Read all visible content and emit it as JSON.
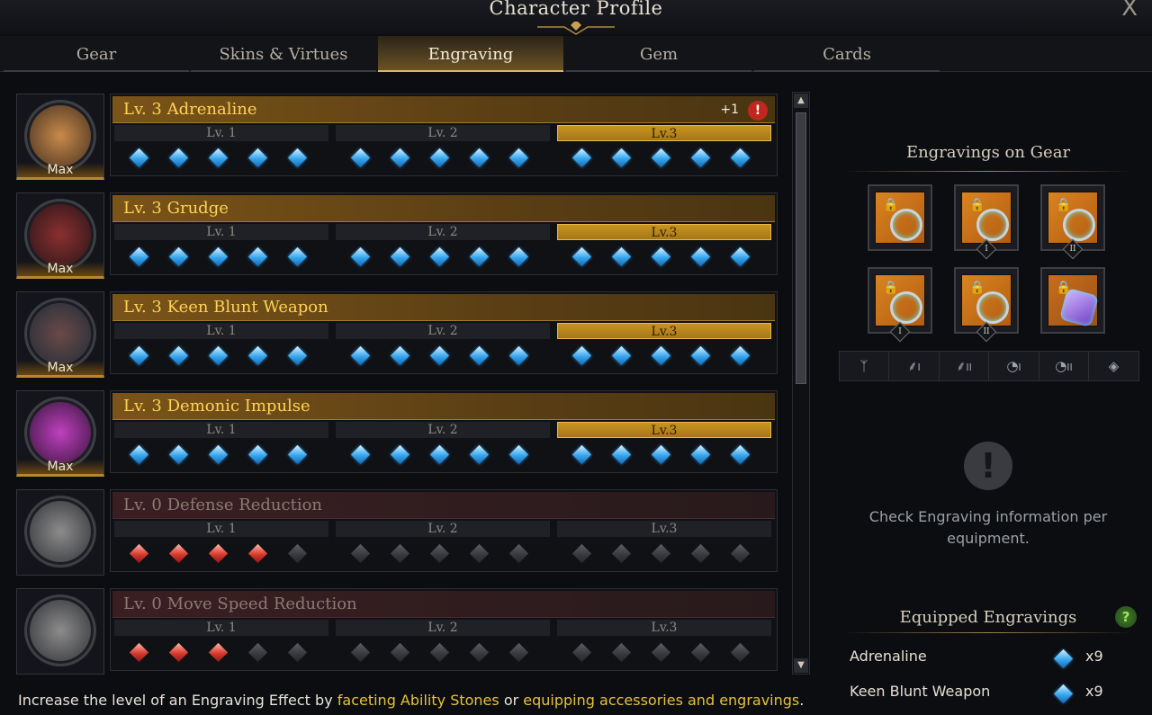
{
  "window": {
    "title": "Character Profile",
    "close_label": "X"
  },
  "tabs": [
    "Gear",
    "Skins & Virtues",
    "Engraving",
    "Gem",
    "Cards"
  ],
  "active_tab_index": 2,
  "colors": {
    "gold": "#ffd257",
    "blue_gem": "#35a6ee",
    "red_gem": "#d83a2e",
    "accent": "#e0b45a"
  },
  "engravings": [
    {
      "name": "Lv. 3 Adrenaline",
      "badge": "Max",
      "plus": "+1",
      "alert": "!",
      "state": "gold",
      "blue": 15,
      "red": 0
    },
    {
      "name": "Lv. 3 Grudge",
      "badge": "Max",
      "plus": "",
      "alert": "",
      "state": "gold",
      "blue": 15,
      "red": 0
    },
    {
      "name": "Lv. 3 Keen Blunt Weapon",
      "badge": "Max",
      "plus": "",
      "alert": "",
      "state": "gold",
      "blue": 15,
      "red": 0
    },
    {
      "name": "Lv. 3 Demonic Impulse",
      "badge": "Max",
      "plus": "",
      "alert": "",
      "state": "gold",
      "blue": 15,
      "red": 0
    },
    {
      "name": "Lv. 0 Defense Reduction",
      "badge": "",
      "plus": "",
      "alert": "",
      "state": "red",
      "blue": 0,
      "red": 4
    },
    {
      "name": "Lv. 0 Move Speed Reduction",
      "badge": "",
      "plus": "",
      "alert": "",
      "state": "red",
      "blue": 0,
      "red": 3
    }
  ],
  "level_labels": [
    "Lv. 1",
    "Lv. 2",
    "Lv.3"
  ],
  "footer": {
    "prefix": "Increase the level of an Engraving Effect by ",
    "link1": "faceting Ability Stones",
    "middle": " or ",
    "link2": "equipping accessories and engravings",
    "suffix": "."
  },
  "gear_panel": {
    "title": "Engravings on Gear",
    "slots": [
      {
        "icon": "necklace-icon",
        "numeral": ""
      },
      {
        "icon": "earring-icon",
        "numeral": "I"
      },
      {
        "icon": "earring-icon",
        "numeral": "II"
      },
      {
        "icon": "ring-icon",
        "numeral": "I"
      },
      {
        "icon": "ring-icon",
        "numeral": "II"
      },
      {
        "icon": "ability-stone-icon",
        "numeral": ""
      }
    ],
    "filter_icons": [
      "necklace-filter-icon",
      "earring-1-filter-icon",
      "earring-2-filter-icon",
      "ring-1-filter-icon",
      "ring-2-filter-icon",
      "stone-filter-icon"
    ],
    "filter_numerals": [
      "",
      "I",
      "II",
      "I",
      "II",
      ""
    ],
    "info_text": "Check Engraving information per equipment."
  },
  "equipped": {
    "title": "Equipped Engravings",
    "help": "?",
    "items": [
      {
        "name": "Adrenaline",
        "count": "x9"
      },
      {
        "name": "Keen Blunt Weapon",
        "count": "x9"
      }
    ]
  }
}
